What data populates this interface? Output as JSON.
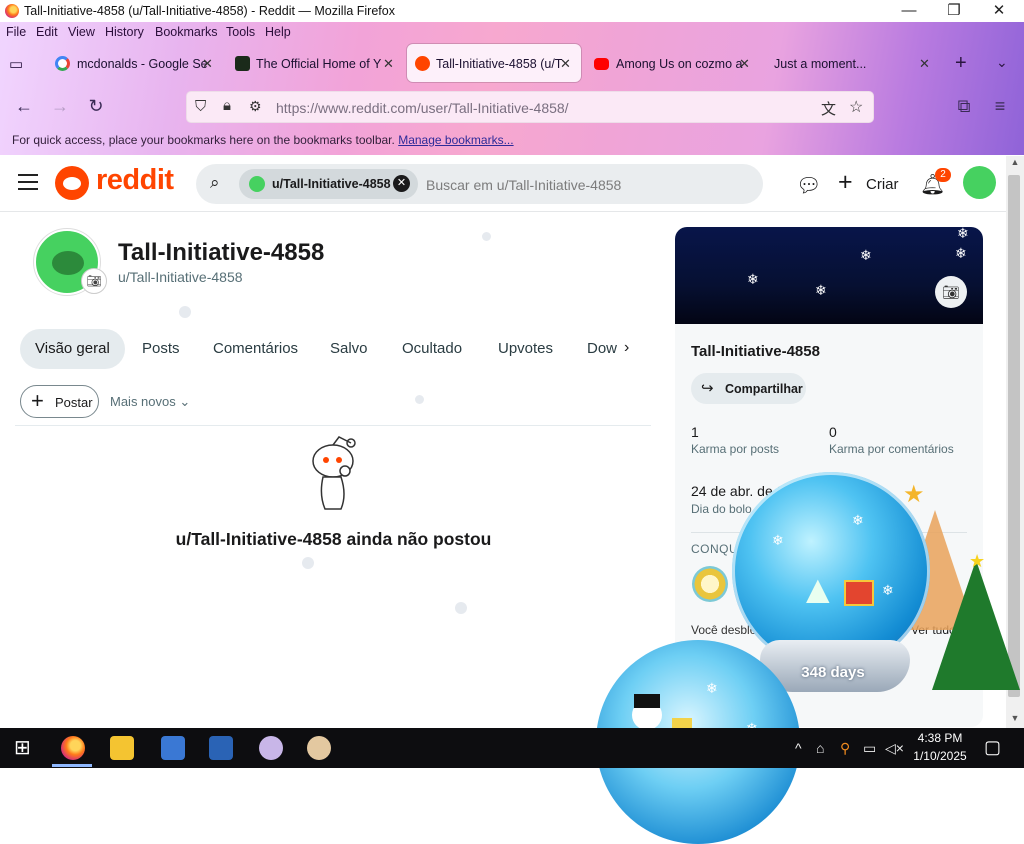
{
  "window": {
    "title": "Tall-Initiative-4858 (u/Tall-Initiative-4858) - Reddit — Mozilla Firefox",
    "minimize": "—",
    "maximize": "❐",
    "close": "✕"
  },
  "menu": [
    "File",
    "Edit",
    "View",
    "History",
    "Bookmarks",
    "Tools",
    "Help"
  ],
  "tabs": [
    {
      "label": "mcdonalds - Google Se",
      "icon": "google-icon",
      "active": false
    },
    {
      "label": "The Official Home of Y",
      "icon": "yoyogames-icon",
      "active": false
    },
    {
      "label": "Tall-Initiative-4858 (u/T",
      "icon": "reddit-icon",
      "active": true
    },
    {
      "label": "Among Us on cozmo a",
      "icon": "youtube-icon",
      "active": false
    },
    {
      "label": "Just a moment...",
      "icon": "loading-icon",
      "active": false
    }
  ],
  "tab_close": "✕",
  "address": {
    "url": "https://www.reddit.com/user/Tall-Initiative-4858/"
  },
  "bookmarks_bar": {
    "text": "For quick access, place your bookmarks here on the bookmarks toolbar.",
    "link": "Manage bookmarks..."
  },
  "reddit": {
    "logo_text": "reddit",
    "search_chip": "u/Tall-Initiative-4858",
    "search_placeholder": "Buscar em u/Tall-Initiative-4858",
    "create": "Criar",
    "notif_count": "2"
  },
  "profile": {
    "name": "Tall-Initiative-4858",
    "handle": "u/Tall-Initiative-4858",
    "tabs": [
      "Visão geral",
      "Posts",
      "Comentários",
      "Salvo",
      "Ocultado",
      "Upvotes",
      "Dow"
    ],
    "post_button": "Postar",
    "sort": "Mais novos",
    "empty_message": "u/Tall-Initiative-4858 ainda não postou"
  },
  "card": {
    "name": "Tall-Initiative-4858",
    "share": "Compartilhar",
    "post_karma": "1",
    "post_karma_label": "Karma por posts",
    "comment_karma": "0",
    "comment_karma_label": "Karma por comentários",
    "cake_day": "24 de abr. de 2",
    "cake_day_label": "Dia do bolo",
    "achievements": "CONQU",
    "achievements_text": "Você desblo",
    "see_all": "Ver tudo"
  },
  "overlay": {
    "globe_label": "348 days"
  },
  "taskbar": {
    "time": "4:38 PM",
    "date": "1/10/2025"
  },
  "colors": {
    "reddit_orange": "#ff4500",
    "active_tab_bg": "#e5ebee",
    "banner": "#08154a"
  }
}
